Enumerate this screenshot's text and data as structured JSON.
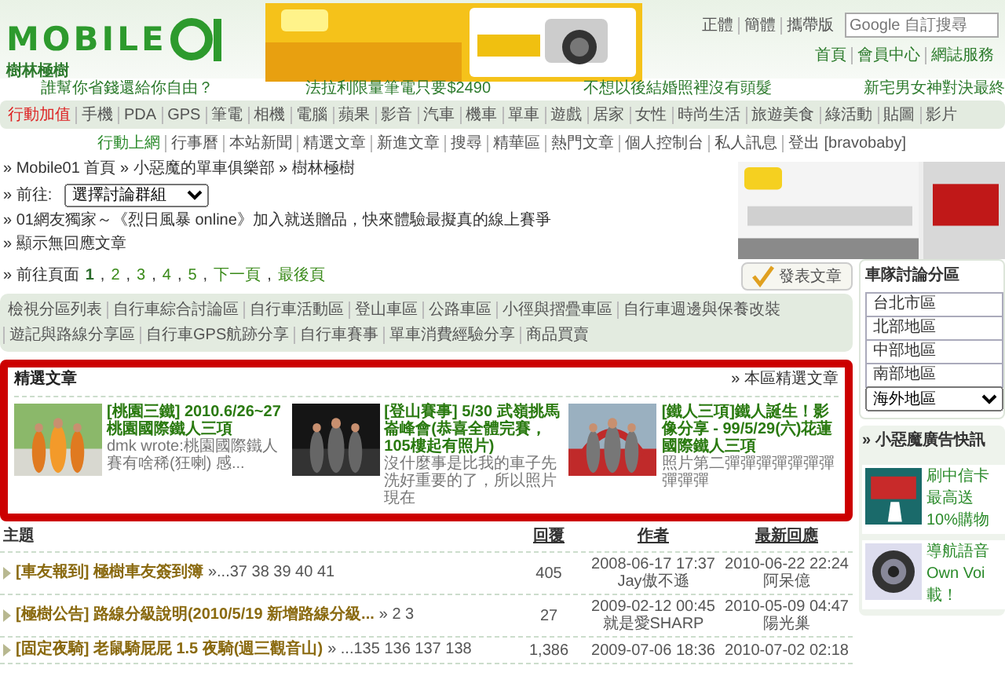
{
  "header": {
    "logo_text": "MOBILE",
    "logo_subtitle": "樹林極樹",
    "lang_links": [
      "正體",
      "簡體",
      "攜帶版"
    ],
    "search": {
      "placeholder": "Google 自訂搜尋"
    },
    "site_links": [
      "首頁",
      "會員中心",
      "網誌服務"
    ]
  },
  "promo_links": [
    "誰幫你省錢還給你自由？",
    "法拉利限量筆電只要$2490",
    "不想以後結婚照裡沒有頭髮",
    "新宅男女神對決最終"
  ],
  "category_nav": [
    {
      "label": "行動加值",
      "selected": true
    },
    {
      "label": "手機",
      "selected": false
    },
    {
      "label": "PDA",
      "selected": false
    },
    {
      "label": "GPS",
      "selected": false
    },
    {
      "label": "筆電",
      "selected": false
    },
    {
      "label": "相機",
      "selected": false
    },
    {
      "label": "電腦",
      "selected": false
    },
    {
      "label": "蘋果",
      "selected": false
    },
    {
      "label": "影音",
      "selected": false
    },
    {
      "label": "汽車",
      "selected": false
    },
    {
      "label": "機車",
      "selected": false
    },
    {
      "label": "單車",
      "selected": false
    },
    {
      "label": "遊戲",
      "selected": false
    },
    {
      "label": "居家",
      "selected": false
    },
    {
      "label": "女性",
      "selected": false
    },
    {
      "label": "時尚生活",
      "selected": false
    },
    {
      "label": "旅遊美食",
      "selected": false
    },
    {
      "label": "綠活動",
      "selected": false
    },
    {
      "label": "貼圖",
      "selected": false
    },
    {
      "label": "影片",
      "selected": false
    }
  ],
  "sub_nav": [
    {
      "label": "行動上網",
      "selected": true
    },
    {
      "label": "行事曆",
      "selected": false
    },
    {
      "label": "本站新聞",
      "selected": false
    },
    {
      "label": "精選文章",
      "selected": false
    },
    {
      "label": "新進文章",
      "selected": false
    },
    {
      "label": "搜尋",
      "selected": false
    },
    {
      "label": "精華區",
      "selected": false
    },
    {
      "label": "熱門文章",
      "selected": false
    },
    {
      "label": "個人控制台",
      "selected": false
    },
    {
      "label": "私人訊息",
      "selected": false
    },
    {
      "label": "登出 [bravobaby]",
      "selected": false
    }
  ],
  "bullet": "»",
  "breadcrumb": [
    "Mobile01 首頁",
    "小惡魔的單車俱樂部",
    "樹林極樹"
  ],
  "goto": {
    "label": "前往:",
    "value": "選擇討論群組"
  },
  "notice": "01網友獨家～《烈日風暴 online》加入就送贈品，快來體驗最擬真的線上賽爭",
  "no_reply_link": "顯示無回應文章",
  "pagination": {
    "label": "前往頁面",
    "separator": ",",
    "pages": [
      {
        "label": "1",
        "selected": true
      },
      {
        "label": "2",
        "selected": false
      },
      {
        "label": "3",
        "selected": false
      },
      {
        "label": "4",
        "selected": false
      },
      {
        "label": "5",
        "selected": false
      },
      {
        "label": "下一頁",
        "selected": false
      },
      {
        "label": "最後頁",
        "selected": false
      }
    ]
  },
  "post_button": "發表文章",
  "subforums": [
    "檢視分區列表",
    "自行車綜合討論區",
    "自行車活動區",
    "登山車區",
    "公路車區",
    "小徑與摺疊車區",
    "自行車週邊與保養改裝",
    "遊記與路線分享區",
    "自行車GPS航跡分享",
    "自行車賽事",
    "單車消費經驗分享",
    "商品買賣"
  ],
  "featured": {
    "title": "精選文章",
    "more": "本區精選文章",
    "items": [
      {
        "title": "[桃園三鐵] 2010.6/26~27桃園國際鐵人三項",
        "excerpt": "dmk wrote:桃園國際鐵人賽有啥稀(狂喇) 感..."
      },
      {
        "title": "[登山賽事] 5/30 武嶺挑馬崙峰會(恭喜全體完賽，105樓起有照片)",
        "excerpt": "沒什麼事是比我的車子先洗好重要的了，所以照片現在"
      },
      {
        "title": "[鐵人三項]鐵人誕生！影像分享 - 99/5/29(六)花蓮國際鐵人三項",
        "excerpt": "照片第二彈彈彈彈彈彈彈彈彈彈"
      }
    ]
  },
  "table": {
    "columns": [
      "主題",
      "回覆",
      "作者",
      "最新回應"
    ],
    "rows": [
      {
        "topic": "[車友報到] 極樹車友簽到簿",
        "pages": "»...37 38 39 40 41",
        "replies": "405",
        "author_time": "2008-06-17 17:37",
        "author": "Jay傲不遜",
        "last_time": "2010-06-22 22:24",
        "last_user": "阿呆億"
      },
      {
        "topic": "[極樹公告] 路線分級說明(2010/5/19 新增路線分級...",
        "pages": "» 2 3",
        "replies": "27",
        "author_time": "2009-02-12 00:45",
        "author": "就是愛SHARP",
        "last_time": "2010-05-09 04:47",
        "last_user": "陽光巢"
      },
      {
        "topic": "[固定夜騎] 老鼠騎屁屁 1.5 夜騎(週三觀音山)",
        "pages": "» ...135 136 137 138",
        "replies": "1,386",
        "author_time": "2009-07-06 18:36",
        "last_time": "2010-07-02 02:18"
      }
    ]
  },
  "districts": {
    "title": "車隊討論分區",
    "items": [
      "台北市區",
      "北部地區",
      "中部地區",
      "南部地區"
    ],
    "select_value": "海外地區"
  },
  "ads": {
    "title": "» 小惡魔廣告快訊",
    "items": [
      {
        "lines": [
          "刷中信卡",
          "最高送",
          "10%購物"
        ]
      },
      {
        "lines": [
          "導航語音",
          "Own Voi",
          "載！"
        ]
      }
    ]
  }
}
